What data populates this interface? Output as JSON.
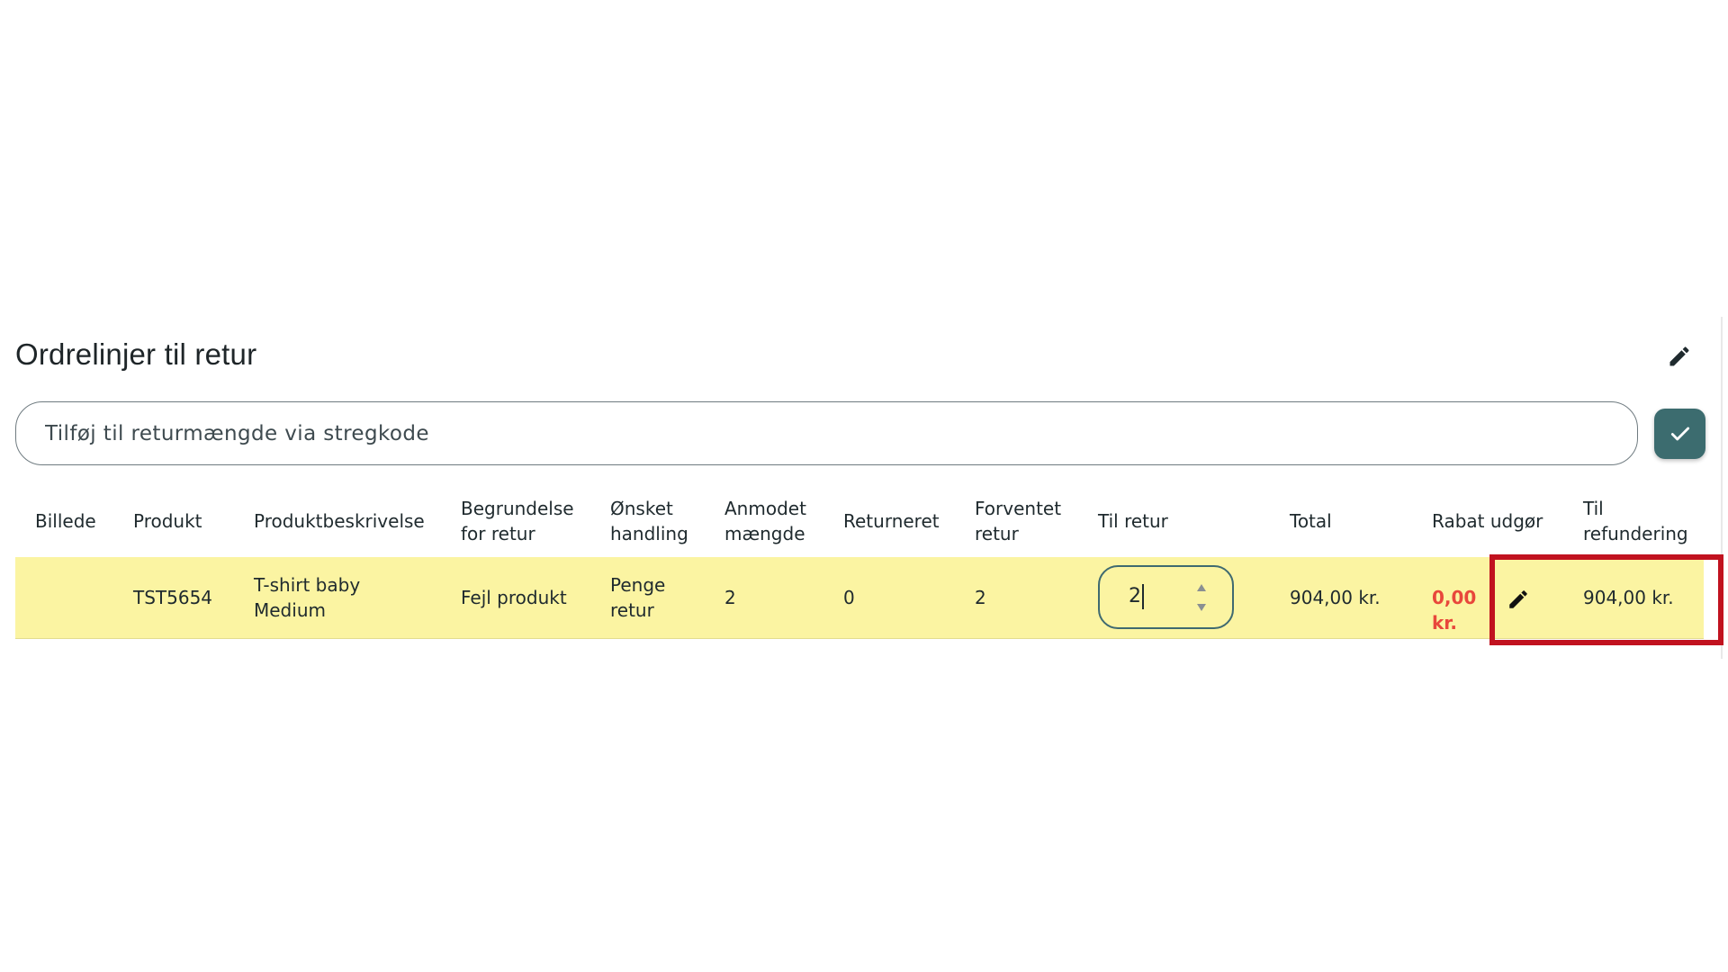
{
  "section": {
    "title": "Ordrelinjer til retur",
    "edit_icon": "pencil-icon"
  },
  "barcode": {
    "placeholder": "Tilføj til returmængde via stregkode",
    "value": "",
    "confirm_icon": "checkmark-icon",
    "confirm_color": "#3c6c6f"
  },
  "table": {
    "headers": [
      "Billede",
      "Produkt",
      "Produktbeskrivelse",
      "Begrundelse\nfor retur",
      "Ønsket\nhandling",
      "Anmodet\nmængde",
      "Returneret",
      "Forventet\nretur",
      "Til retur",
      "Total",
      "Rabat udgør",
      "Til\nrefundering"
    ],
    "rows": [
      {
        "image": "",
        "product": "TST5654",
        "description": "T-shirt baby\nMedium",
        "reason": "Fejl produkt",
        "action": "Penge\nretur",
        "requested_qty": "2",
        "returned": "0",
        "expected_return": "2",
        "to_return": "2",
        "total": "904,00 kr.",
        "discount": "0,00 kr.",
        "refund": "904,00 kr."
      }
    ],
    "row_highlight_color": "#fbf4a2",
    "discount_color": "#e8473b"
  },
  "annotation": {
    "box_color": "#c1121f"
  }
}
